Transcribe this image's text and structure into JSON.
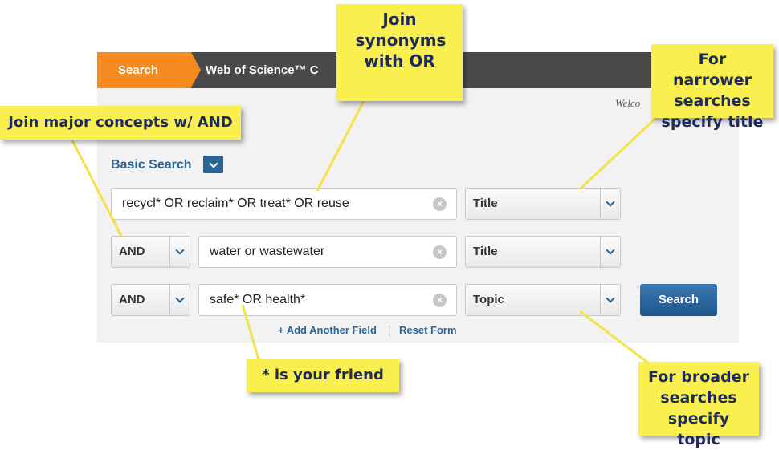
{
  "header": {
    "search_crumb": "Search",
    "product_crumb": "Web of Science™ C",
    "welcome": "Welco"
  },
  "basic_search": {
    "title": "Basic Search"
  },
  "rows": [
    {
      "operator": "",
      "query": "recycl* OR reclaim* OR treat* OR reuse",
      "field": "Title"
    },
    {
      "operator": "AND",
      "query": "water or wastewater",
      "field": "Title"
    },
    {
      "operator": "AND",
      "query": "safe* OR health*",
      "field": "Topic"
    }
  ],
  "actions": {
    "search_button": "Search",
    "add_field": "+ Add Another Field",
    "separator": "|",
    "reset": "Reset Form"
  },
  "annotations": {
    "join_synonyms": "Join synonyms with OR",
    "join_major": "Join major concepts w/ AND",
    "narrower": "For narrower searches specify title",
    "wildcard": "* is your friend",
    "broader": "For broader searches specify topic"
  },
  "colors": {
    "accent": "#f58a1f",
    "link": "#2a6496",
    "note_bg": "#f9ef4f",
    "note_text": "#1e2a5a"
  }
}
